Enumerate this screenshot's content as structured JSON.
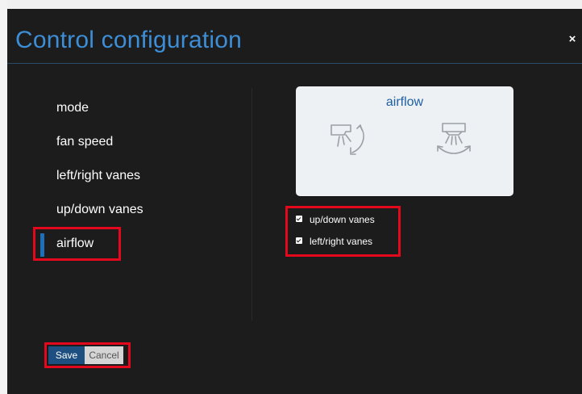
{
  "dialog": {
    "title": "Control configuration",
    "close_label": "×"
  },
  "nav": {
    "items": [
      {
        "label": "mode"
      },
      {
        "label": "fan speed"
      },
      {
        "label": "left/right vanes"
      },
      {
        "label": "up/down vanes"
      },
      {
        "label": "airflow",
        "active": true
      }
    ]
  },
  "preview": {
    "title": "airflow",
    "icons": [
      "vane-up-down-icon",
      "vane-left-right-icon"
    ]
  },
  "options": [
    {
      "label": "up/down vanes",
      "checked": true
    },
    {
      "label": "left/right vanes",
      "checked": true
    }
  ],
  "buttons": {
    "save_label": "Save",
    "cancel_label": "Cancel"
  },
  "colors": {
    "title": "#3d8ed6",
    "accent": "#1d6fb8",
    "highlight": "#e3081b",
    "save_bg": "#1d4f80",
    "background": "#1c1c1c"
  }
}
